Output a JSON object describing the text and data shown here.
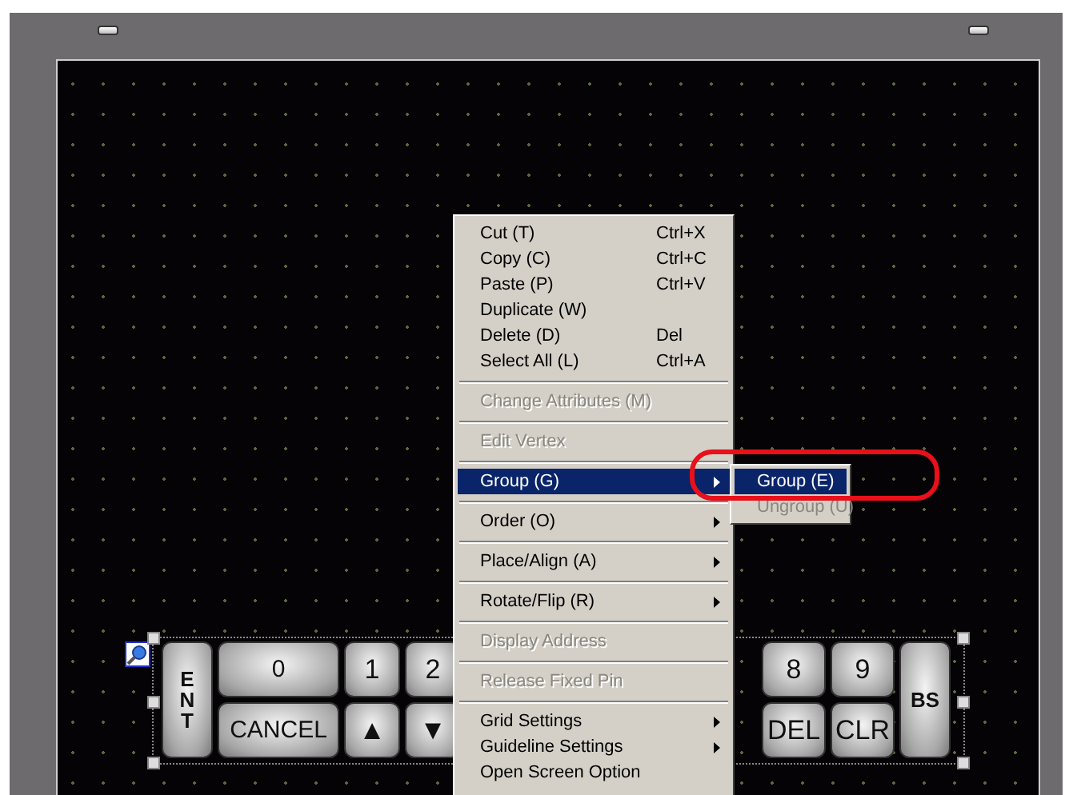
{
  "keypad_left": [
    {
      "label": "ENT",
      "kind": "vertical"
    },
    {
      "label": "0",
      "kind": "wide"
    },
    {
      "label": "1",
      "kind": "normal"
    },
    {
      "label": "2",
      "kind": "normal"
    },
    {
      "label": "CANCEL",
      "kind": "wide"
    },
    {
      "label": "▲",
      "kind": "normal"
    },
    {
      "label": "▼",
      "kind": "normal"
    }
  ],
  "keypad_right": [
    {
      "label": "8",
      "kind": "normal"
    },
    {
      "label": "9",
      "kind": "normal"
    },
    {
      "label": "BS",
      "kind": "tall"
    },
    {
      "label": "DEL",
      "kind": "normal"
    },
    {
      "label": "CLR",
      "kind": "normal"
    }
  ],
  "context_menu": {
    "sections": [
      {
        "items": [
          {
            "label": "Cut (T)",
            "shortcut": "Ctrl+X",
            "disabled": false,
            "selected": false,
            "submenu": false
          },
          {
            "label": "Copy (C)",
            "shortcut": "Ctrl+C",
            "disabled": false,
            "selected": false,
            "submenu": false
          },
          {
            "label": "Paste (P)",
            "shortcut": "Ctrl+V",
            "disabled": false,
            "selected": false,
            "submenu": false
          },
          {
            "label": "Duplicate (W)",
            "disabled": false,
            "selected": false,
            "submenu": false
          },
          {
            "label": "Delete (D)",
            "shortcut": "Del",
            "disabled": false,
            "selected": false,
            "submenu": false
          },
          {
            "label": "Select All (L)",
            "shortcut": "Ctrl+A",
            "disabled": false,
            "selected": false,
            "submenu": false
          }
        ]
      },
      {
        "items": [
          {
            "label": "Change Attributes (M)",
            "disabled": true,
            "selected": false,
            "submenu": false
          }
        ]
      },
      {
        "items": [
          {
            "label": "Edit Vertex",
            "disabled": true,
            "selected": false,
            "submenu": false
          }
        ]
      },
      {
        "items": [
          {
            "label": "Group (G)",
            "disabled": false,
            "selected": true,
            "submenu": true
          }
        ]
      },
      {
        "items": [
          {
            "label": "Order (O)",
            "disabled": false,
            "selected": false,
            "submenu": true
          }
        ]
      },
      {
        "items": [
          {
            "label": "Place/Align (A)",
            "disabled": false,
            "selected": false,
            "submenu": true
          }
        ]
      },
      {
        "items": [
          {
            "label": "Rotate/Flip (R)",
            "disabled": false,
            "selected": false,
            "submenu": true
          }
        ]
      },
      {
        "items": [
          {
            "label": "Display Address",
            "disabled": true,
            "selected": false,
            "submenu": false
          }
        ]
      },
      {
        "items": [
          {
            "label": "Release Fixed Pin",
            "disabled": true,
            "selected": false,
            "submenu": false
          }
        ]
      },
      {
        "items": [
          {
            "label": "Grid Settings",
            "disabled": false,
            "selected": false,
            "submenu": true
          },
          {
            "label": "Guideline Settings",
            "disabled": false,
            "selected": false,
            "submenu": true
          },
          {
            "label": "Open Screen Option",
            "disabled": false,
            "selected": false,
            "submenu": false
          }
        ]
      }
    ]
  },
  "submenu": {
    "items": [
      {
        "label": "Group (E)",
        "disabled": false,
        "selected": true
      },
      {
        "label": "Ungroup (U)",
        "disabled": true,
        "selected": false
      }
    ]
  },
  "highlight_ring": true
}
